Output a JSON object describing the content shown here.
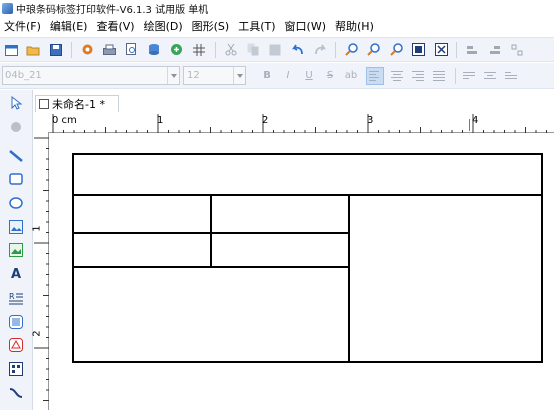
{
  "window": {
    "title": "中琅条码标签打印软件-V6.1.3 试用版 单机"
  },
  "menu": [
    {
      "label": "文件(F)"
    },
    {
      "label": "编辑(E)"
    },
    {
      "label": "查看(V)"
    },
    {
      "label": "绘图(D)"
    },
    {
      "label": "图形(S)"
    },
    {
      "label": "工具(T)"
    },
    {
      "label": "窗口(W)"
    },
    {
      "label": "帮助(H)"
    }
  ],
  "format_bar": {
    "font_value": "04b_21",
    "size_value": "12",
    "bold": "B",
    "italic": "I",
    "underline": "U",
    "strike": "S",
    "extra": "ab"
  },
  "document": {
    "tab_label": "未命名-1 *"
  },
  "ruler": {
    "h_labels": [
      "0 cm",
      "1",
      "2",
      "3",
      "4"
    ],
    "v_labels": [
      "1",
      "2"
    ]
  },
  "colors": {
    "accent": "#2a5fae",
    "toolbar_bg": "#f0f4fa",
    "red_icon": "#d62b2b",
    "blue_icon": "#2f6fce",
    "green_icon": "#2e9a45"
  }
}
